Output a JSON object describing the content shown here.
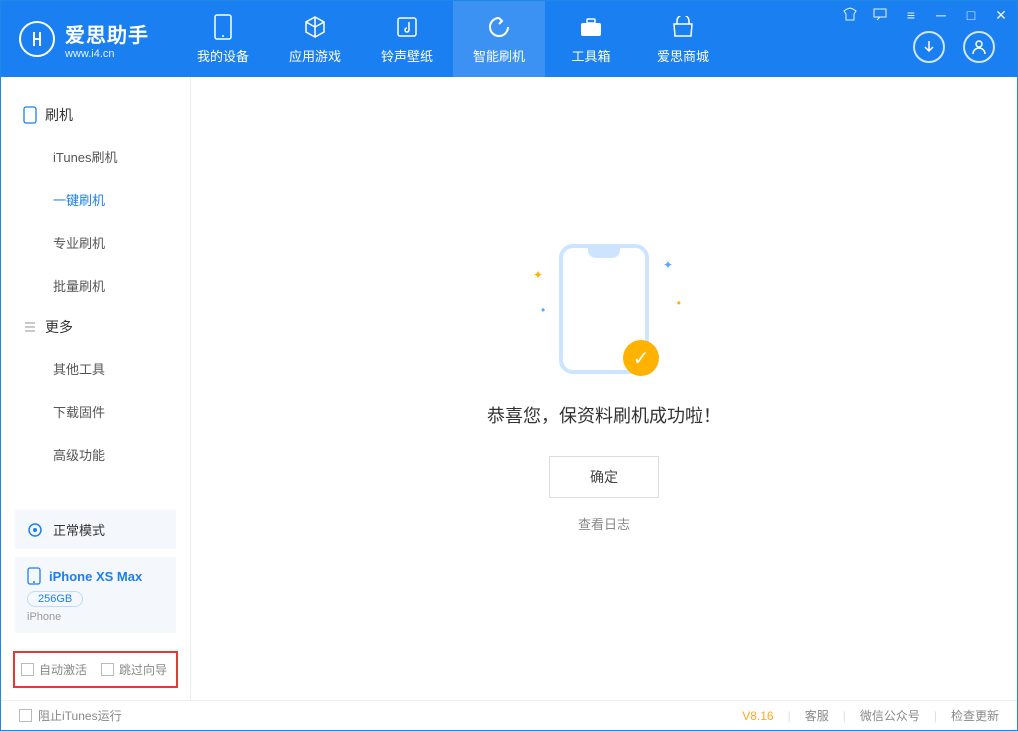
{
  "app": {
    "name": "爱思助手",
    "url": "www.i4.cn"
  },
  "topnav": [
    {
      "label": "我的设备"
    },
    {
      "label": "应用游戏"
    },
    {
      "label": "铃声壁纸"
    },
    {
      "label": "智能刷机"
    },
    {
      "label": "工具箱"
    },
    {
      "label": "爱思商城"
    }
  ],
  "sidebar": {
    "group1_title": "刷机",
    "group1_items": [
      "iTunes刷机",
      "一键刷机",
      "专业刷机",
      "批量刷机"
    ],
    "group2_title": "更多",
    "group2_items": [
      "其他工具",
      "下载固件",
      "高级功能"
    ]
  },
  "mode_label": "正常模式",
  "device": {
    "name": "iPhone XS Max",
    "capacity": "256GB",
    "type": "iPhone"
  },
  "checkboxes": {
    "auto_activate": "自动激活",
    "skip_guide": "跳过向导"
  },
  "main": {
    "success_text": "恭喜您，保资料刷机成功啦！",
    "confirm_label": "确定",
    "log_link": "查看日志"
  },
  "statusbar": {
    "block_itunes": "阻止iTunes运行",
    "version": "V8.16",
    "links": [
      "客服",
      "微信公众号",
      "检查更新"
    ]
  }
}
